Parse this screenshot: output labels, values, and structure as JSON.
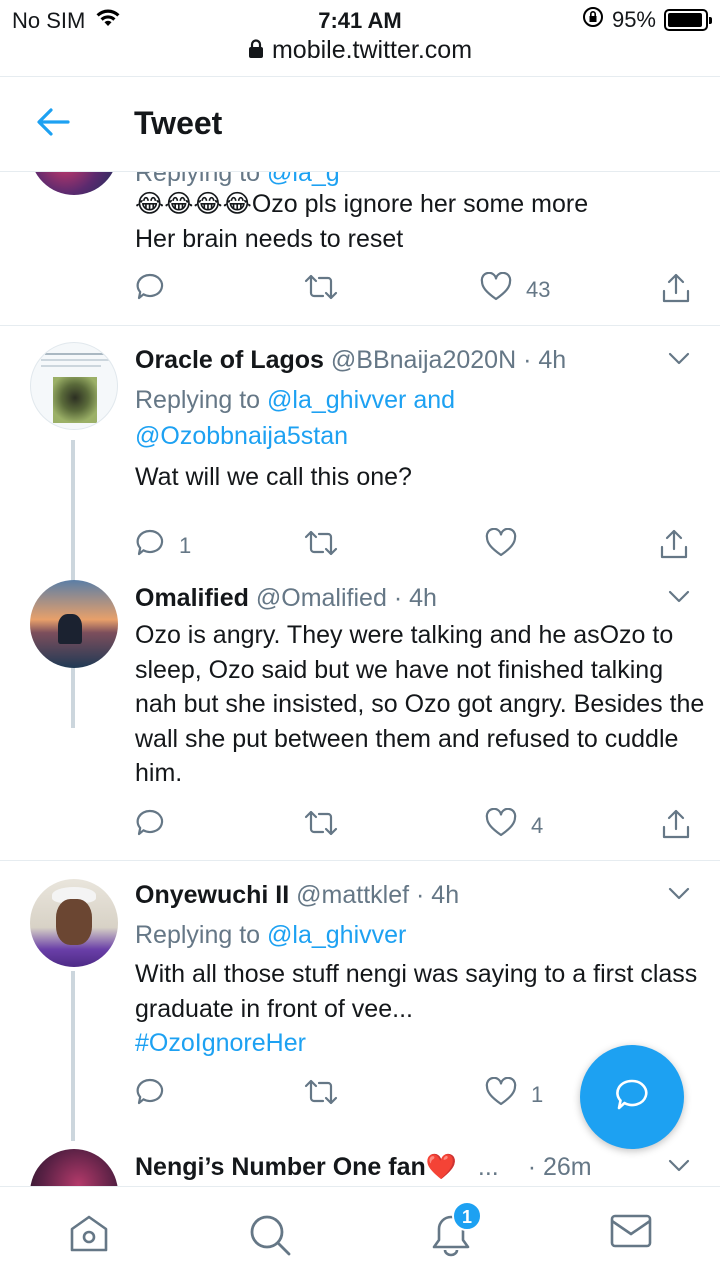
{
  "status_bar": {
    "carrier": "No SIM",
    "time": "7:41 AM",
    "battery": "95%",
    "battery_level": 0.95
  },
  "browser": {
    "url": "mobile.twitter.com"
  },
  "header": {
    "title": "Tweet"
  },
  "tweets": [
    {
      "body_emoji": "😂😂😂😂",
      "body": "Ozo pls ignore her some more\nHer brain needs to reset",
      "likes": "43"
    },
    {
      "name": "Oracle of Lagos",
      "handle": "@BBnaija2020N",
      "time": "· 4h",
      "replying_prefix": "Replying to",
      "replying_to_1": "@la_ghivver",
      "replying_and": "and",
      "replying_to_2": "@Ozobbnaija5stan",
      "body": "Wat will we call this one?",
      "replies": "1"
    },
    {
      "name": "Omalified",
      "handle": "@Omalified",
      "time": "· 4h",
      "body": "Ozo is angry. They were talking and he asOzo to sleep, Ozo said but we have not finished talking nah but she insisted, so Ozo got angry. Besides the wall she put between them and refused to cuddle him.",
      "likes": "4"
    },
    {
      "name": "Onyewuchi II",
      "handle": "@mattklef",
      "time": "· 4h",
      "replying_prefix": "Replying to",
      "replying_to_1": "@la_ghivver",
      "body": "With all those stuff nengi was saying to a first class graduate in front of vee...",
      "hashtag": "#OzoIgnoreHer",
      "likes": "1"
    },
    {
      "name": "Nengi’s Number One fan",
      "heart": "❤️",
      "ellipsis": "...",
      "time": "· 26m"
    }
  ],
  "nav": {
    "notifications_badge": "1"
  },
  "icons": [
    "wifi-icon",
    "lock-icon",
    "back-arrow-icon",
    "reply-icon",
    "retweet-icon",
    "like-icon",
    "share-icon",
    "chevron-down-icon",
    "compose-icon",
    "home-icon",
    "search-icon",
    "bell-icon",
    "mail-icon"
  ],
  "colors": {
    "accent": "#1da1f2",
    "secondary_text": "#657786",
    "divider": "#e6ecf0"
  }
}
